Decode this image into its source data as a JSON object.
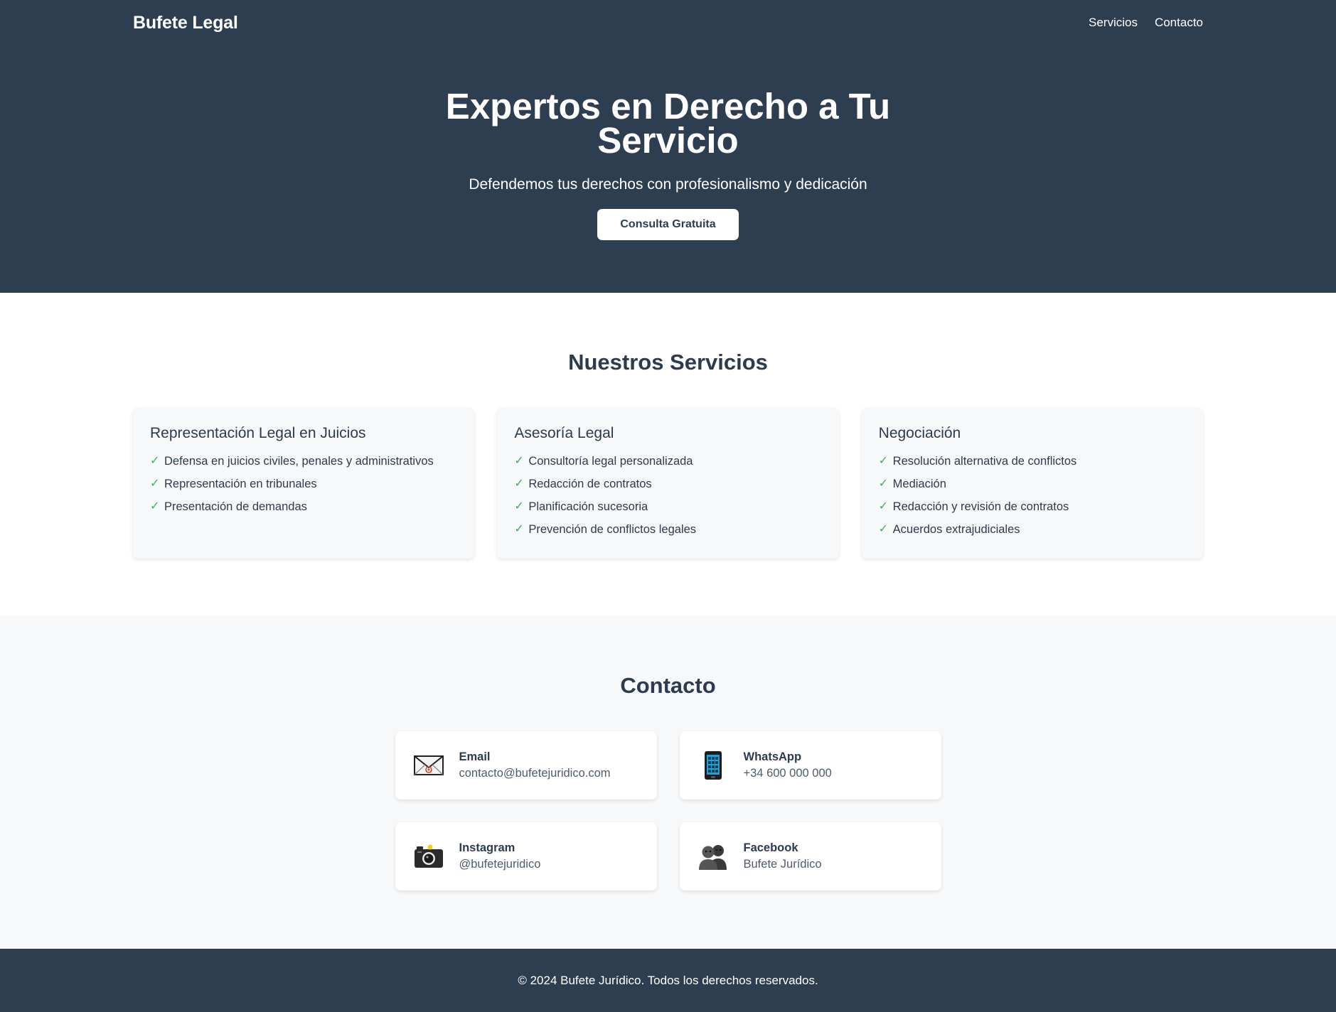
{
  "header": {
    "brand": "Bufete Legal",
    "nav": [
      "Servicios",
      "Contacto"
    ]
  },
  "hero": {
    "title": "Expertos en Derecho a Tu Servicio",
    "subtitle": "Defendemos tus derechos con profesionalismo y dedicación",
    "cta": "Consulta Gratuita"
  },
  "services": {
    "title": "Nuestros Servicios",
    "cards": [
      {
        "title": "Representación Legal en Juicios",
        "items": [
          "Defensa en juicios civiles, penales y administrativos",
          "Representación en tribunales",
          "Presentación de demandas"
        ]
      },
      {
        "title": "Asesoría Legal",
        "items": [
          "Consultoría legal personalizada",
          "Redacción de contratos",
          "Planificación sucesoria",
          "Prevención de conflictos legales"
        ]
      },
      {
        "title": "Negociación",
        "items": [
          "Resolución alternativa de conflictos",
          "Mediación",
          "Redacción y revisión de contratos",
          "Acuerdos extrajudiciales"
        ]
      }
    ],
    "check_glyph": "✓"
  },
  "contact": {
    "title": "Contacto",
    "items": [
      {
        "icon": "envelope-icon",
        "label": "Email",
        "value": "contacto@bufetejuridico.com"
      },
      {
        "icon": "mobile-phone-icon",
        "label": "WhatsApp",
        "value": "+34 600 000 000"
      },
      {
        "icon": "camera-icon",
        "label": "Instagram",
        "value": "@bufetejuridico"
      },
      {
        "icon": "people-icon",
        "label": "Facebook",
        "value": "Bufete Jurídico"
      }
    ]
  },
  "footer": {
    "text": "© 2024 Bufete Jurídico. Todos los derechos reservados."
  },
  "colors": {
    "primary_dark": "#2e3e51",
    "check_green": "#3fae62",
    "section_bg": "#f7f8fa"
  }
}
